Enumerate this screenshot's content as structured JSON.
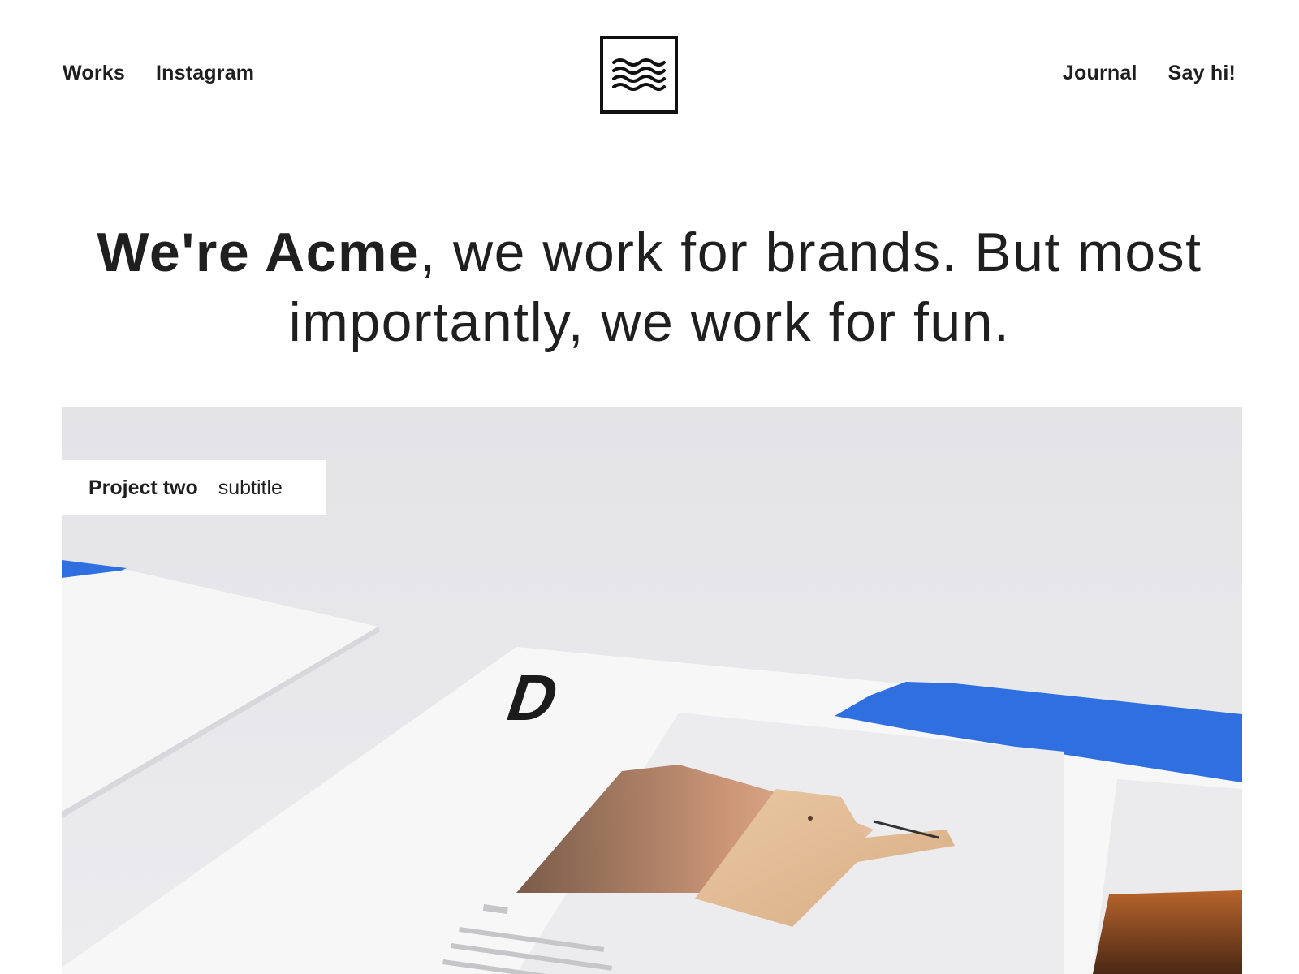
{
  "nav": {
    "left": [
      {
        "label": "Works"
      },
      {
        "label": "Instagram"
      }
    ],
    "right": [
      {
        "label": "Journal"
      },
      {
        "label": "Say hi!"
      }
    ],
    "logo_icon": "waves-icon"
  },
  "hero": {
    "bold": "We're Acme",
    "rest_line1": ", we work for brands. But most",
    "line2": "importantly, we work for fun."
  },
  "feature": {
    "title": "Project two",
    "subtitle": "subtitle",
    "image_letter": "D"
  },
  "colors": {
    "text": "#1f1f1f",
    "accent_blue": "#2f6fe0",
    "image_bg": "#e6e6e9"
  }
}
